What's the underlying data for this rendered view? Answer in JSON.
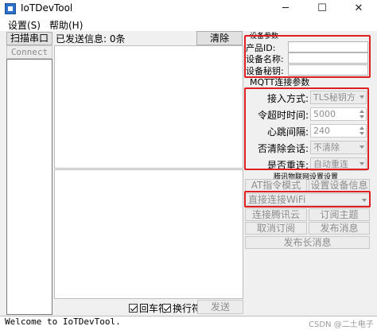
{
  "window": {
    "title": "IoTDevTool",
    "min_icon": "minimize-icon",
    "max_icon": "maximize-icon",
    "close_icon": "close-icon",
    "min_glyph": "─",
    "max_glyph": "☐",
    "close_glyph": "✕"
  },
  "menu": {
    "settings": "设置(S)",
    "help": "帮助(H)"
  },
  "left": {
    "scan_button": "扫描串口",
    "connect_button": "Connect",
    "sent_info": "已发送信息: 0条",
    "clear_button": "清除",
    "crlf_label": "回车符",
    "wrap_label": "换行符",
    "send_button": "发送"
  },
  "status": {
    "text": "Welcome to IoTDevTool.",
    "watermark": "CSDN @二土电子"
  },
  "device_params": {
    "title": "设备参数",
    "product_id_label": "产品ID:",
    "product_id_value": "",
    "device_name_label": "设备名称:",
    "device_name_value": "",
    "device_secret_label": "设备秘钥:",
    "device_secret_value": ""
  },
  "mqtt": {
    "title": "MQTT连接参数",
    "access_mode_label": "接入方式:",
    "access_mode_value": "TLS秘钥方",
    "timeout_label": "令超时时间:",
    "timeout_value": "5000",
    "heartbeat_label": "心跳间隔:",
    "heartbeat_value": "240",
    "clean_session_label": "否清除会话:",
    "clean_session_value": "不清除",
    "auto_reconnect_label": "是否重连:",
    "auto_reconnect_value": "自动重连"
  },
  "iot": {
    "title": "腾讯物联网设置设置",
    "at_mode": "AT指令模式",
    "set_device_info": "设置设备信息",
    "wifi_select": "直接连接WiFi",
    "connect_tencent": "连接腾讯云",
    "subscribe_topic": "订阅主题",
    "unsubscribe": "取消订阅",
    "publish": "发布消息",
    "publish_long": "发布长消息"
  },
  "colors": {
    "highlight": "#e02020",
    "disabled_text": "#8d8d8d"
  }
}
